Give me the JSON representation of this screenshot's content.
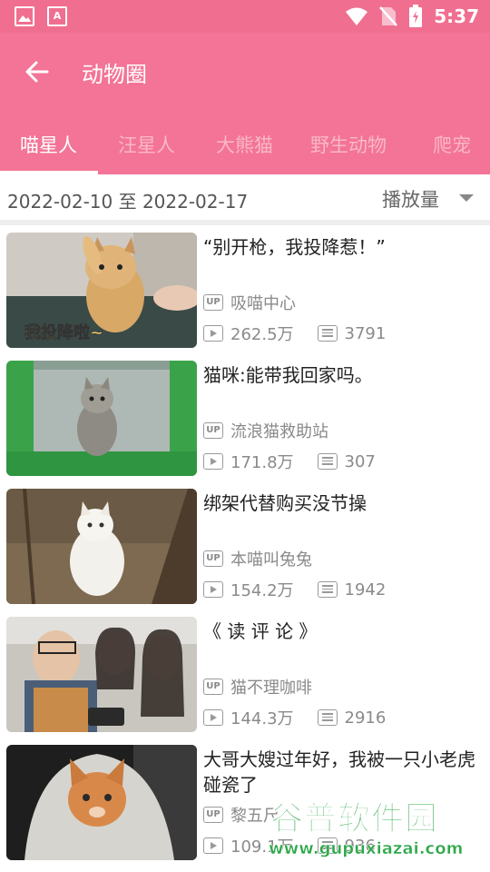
{
  "status_bar": {
    "time": "5:37",
    "icons": [
      "image-icon",
      "a-icon",
      "wifi-icon",
      "no-sim-icon",
      "battery-icon"
    ],
    "a_icon_letter": "A"
  },
  "header": {
    "title": "动物圈",
    "back_icon": "arrow-left-icon"
  },
  "tabs": [
    {
      "label": "喵星人",
      "active": true
    },
    {
      "label": "汪星人",
      "active": false
    },
    {
      "label": "大熊猫",
      "active": false
    },
    {
      "label": "野生动物",
      "active": false
    },
    {
      "label": "爬宠",
      "active": false
    }
  ],
  "filter": {
    "date_range": "2022-02-10 至 2022-02-17",
    "sort_label": "播放量",
    "sort_icon": "triangle-down-icon"
  },
  "badge_up": "UP",
  "videos": [
    {
      "title": "“别开枪，我投降惹！”",
      "uploader": "吸喵中心",
      "plays": "262.5万",
      "danmaku": "3791"
    },
    {
      "title": "猫咪:能带我回家吗。",
      "uploader": "流浪猫救助站",
      "plays": "171.8万",
      "danmaku": "307"
    },
    {
      "title": "绑架代替购买没节操",
      "uploader": "本喵叫兔兔",
      "plays": "154.2万",
      "danmaku": "1942"
    },
    {
      "title": "《 读 评 论 》",
      "uploader": "猫不理咖啡",
      "plays": "144.3万",
      "danmaku": "2916"
    },
    {
      "title": "大哥大嫂过年好，我被一只小老虎碰瓷了",
      "uploader": "黎五尺",
      "plays": "109.1万",
      "danmaku": "936"
    }
  ],
  "thumb_captions": {
    "first": "我投降啦~"
  },
  "watermark": {
    "brand": "谷普软件园",
    "url": "www.gupuxiazai.com"
  },
  "colors": {
    "header_pink": "#f37496",
    "status_pink": "#f06f90",
    "tab_inactive": "#f9b7c8",
    "watermark_green": "#2ea84a"
  }
}
